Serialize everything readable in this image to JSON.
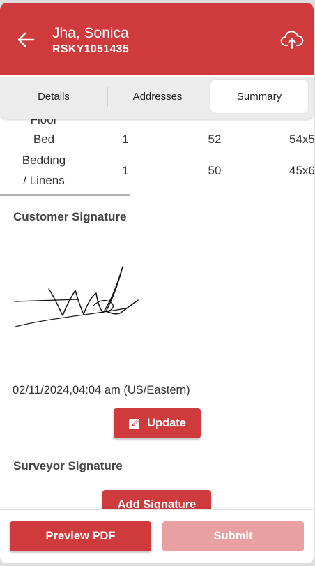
{
  "header": {
    "customer_name": "Jha, Sonica",
    "customer_id": "RSKY1051435",
    "accent_color": "#cf3a3c"
  },
  "tabs": [
    {
      "label": "Details",
      "active": false
    },
    {
      "label": "Addresses",
      "active": false
    },
    {
      "label": "Summary",
      "active": true
    }
  ],
  "inventory_table": {
    "rows": [
      {
        "item": "Floor",
        "qty": "",
        "value": "",
        "dims": ""
      },
      {
        "item": "Bed",
        "qty": "1",
        "value": "52",
        "dims": "54x5"
      },
      {
        "item_line1": "Bedding",
        "item_line2": "/ Linens",
        "qty": "1",
        "value": "50",
        "dims": "45x6"
      }
    ]
  },
  "customer_signature": {
    "title": "Customer Signature",
    "timestamp": "02/11/2024,04:04 am (US/Eastern)",
    "update_label": "Update"
  },
  "surveyor_signature": {
    "title": "Surveyor Signature",
    "add_label": "Add Signature"
  },
  "footer": {
    "preview_label": "Preview PDF",
    "submit_label": "Submit",
    "submit_disabled": true
  },
  "icons": [
    "arrow-left-icon",
    "cloud-upload-icon",
    "edit-icon"
  ]
}
